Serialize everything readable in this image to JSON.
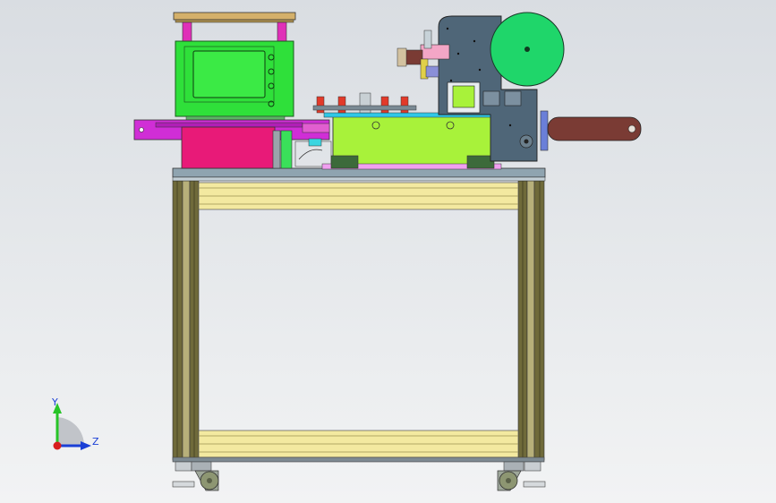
{
  "viewport": {
    "background_top": "#d9dde2",
    "background_bottom": "#f2f3f4"
  },
  "triad": {
    "y_label": "Y",
    "z_label": "Z",
    "y_color": "#27c427",
    "z_color": "#1a3fd6",
    "origin_color": "#d81e1e"
  },
  "colors": {
    "frame_profile": "#6f6a3a",
    "frame_profile_light": "#b7b07a",
    "crossbar": "#f3e9a0",
    "top_plate": "#8fa4b0",
    "controller_box": "#2fe03a",
    "magenta_block": "#e81a78",
    "lime_carriage": "#a8f23a",
    "purple_arm": "#d02ed6",
    "steel_blue_plate": "#4f6678",
    "reel_green": "#1fd66a",
    "brown_arm": "#7a3b34"
  }
}
